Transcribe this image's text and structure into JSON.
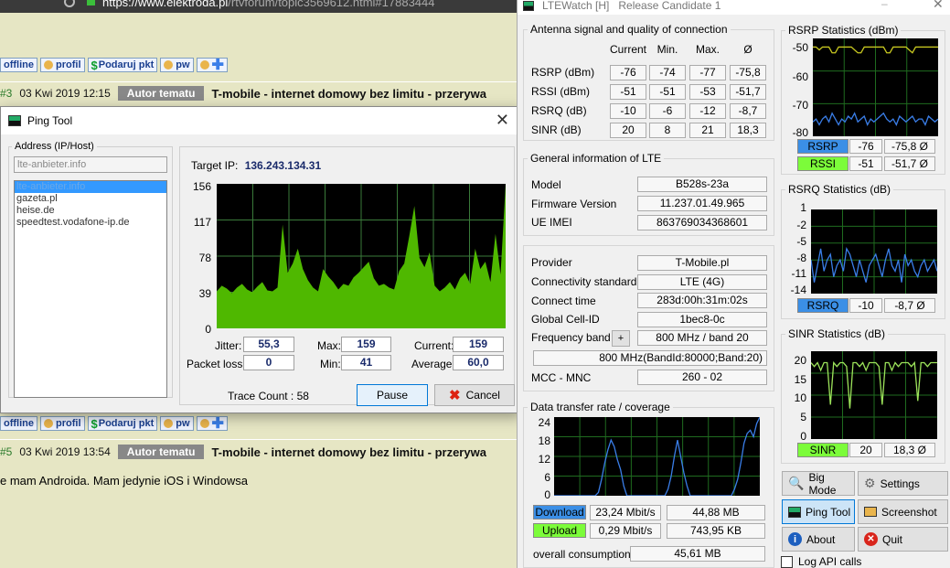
{
  "browser": {
    "url_host": "https://www.elektroda.pl",
    "url_path": "/rtvforum/topic3569612.html#17883444"
  },
  "forum": {
    "btn_offline": "offline",
    "btn_profil": "profil",
    "btn_podaruj": "Podaruj pkt",
    "btn_pw": "pw",
    "post1": {
      "num": "#3",
      "date": "03 Kwi 2019 12:15",
      "badge": "Autor tematu",
      "title": "T-mobile - internet domowy bez limitu - przerywa"
    },
    "post2": {
      "num": "#5",
      "date": "03 Kwi 2019 13:54",
      "badge": "Autor tematu",
      "title": "T-mobile - internet domowy bez limitu - przerywa"
    },
    "post2_text": "e mam Androida. Mam jedynie iOS i Windowsa"
  },
  "ping": {
    "title": "Ping Tool",
    "address_label": "Address (IP/Host)",
    "address_input": "lte-anbieter.info",
    "hosts": [
      "lte-anbieter.info",
      "gazeta.pl",
      "heise.de",
      "speedtest.vodafone-ip.de"
    ],
    "target_label": "Target IP:",
    "target_ip": "136.243.134.31",
    "y_ticks": [
      "156",
      "117",
      "78",
      "39",
      "0"
    ],
    "jitter_label": "Jitter:",
    "jitter": "55,3",
    "max_label": "Max:",
    "max": "159",
    "current_label": "Current:",
    "current": "159",
    "loss_label": "Packet loss:",
    "loss": "0",
    "min_label": "Min:",
    "min": "41",
    "avg_label": "Average:",
    "avg": "60,0",
    "trace_count": "Trace Count : 58",
    "pause": "Pause",
    "cancel": "Cancel",
    "colors": {
      "fill": "#4fb800",
      "grid": "#3a7a3a"
    },
    "samples": [
      40,
      46,
      43,
      38,
      44,
      48,
      42,
      39,
      45,
      50,
      41,
      40,
      44,
      112,
      60,
      70,
      86,
      64,
      52,
      44,
      40,
      64,
      56,
      50,
      42,
      48,
      46,
      55,
      60,
      66,
      72,
      54,
      46,
      48,
      44,
      42,
      62,
      70,
      100,
      132,
      76,
      66,
      82,
      46,
      40,
      44,
      50,
      42,
      54,
      60,
      48,
      86,
      64,
      72,
      50,
      102,
      58,
      159
    ]
  },
  "lte": {
    "title": "LTEWatch [H]   Release Candidate 1",
    "antenna": {
      "title": "Antenna signal and quality of connection",
      "cols": [
        "Current",
        "Min.",
        "Max.",
        "Ø"
      ],
      "rows": [
        {
          "label": "RSRP (dBm)",
          "v": [
            "-76",
            "-74",
            "-77",
            "-75,8"
          ]
        },
        {
          "label": "RSSI (dBm)",
          "v": [
            "-51",
            "-51",
            "-53",
            "-51,7"
          ]
        },
        {
          "label": "RSRQ (dB)",
          "v": [
            "-10",
            "-6",
            "-12",
            "-8,7"
          ]
        },
        {
          "label": "SINR (dB)",
          "v": [
            "20",
            "8",
            "21",
            "18,3"
          ]
        }
      ]
    },
    "general": {
      "title": "General information of LTE",
      "rows": [
        {
          "label": "Model",
          "value": "B528s-23a"
        },
        {
          "label": "Firmware Version",
          "value": "11.237.01.49.965"
        },
        {
          "label": "UE IMEI",
          "value": "863769034368601"
        }
      ]
    },
    "provider": {
      "rows": [
        {
          "label": "Provider",
          "value": "T-Mobile.pl"
        },
        {
          "label": "Connectivity standard",
          "value": "LTE (4G)"
        },
        {
          "label": "Connect time",
          "value": "283d:00h:31m:02s"
        },
        {
          "label": "Global Cell-ID",
          "value": "1bec8-0c"
        },
        {
          "label": "Frequency band",
          "value": "800 MHz / band 20"
        }
      ],
      "plus": "+",
      "band_detail": "800 MHz(BandId:80000;Band:20)",
      "mcc_label": "MCC - MNC",
      "mcc_value": "260 - 02"
    },
    "transfer": {
      "title": "Data transfer rate / coverage",
      "y_ticks": [
        "24",
        "18",
        "12",
        "6",
        "0"
      ],
      "download_label": "Download",
      "download_rate": "23,24 Mbit/s",
      "download_total": "44,88 MB",
      "upload_label": "Upload",
      "upload_rate": "0,29 Mbit/s",
      "upload_total": "743,95 KB",
      "overall_label": "overall consumption",
      "overall_value": "45,61 MB",
      "series": [
        0,
        0,
        0,
        0,
        0,
        0,
        0,
        0,
        0,
        0,
        0,
        0,
        0,
        0,
        1,
        5,
        10,
        14,
        17,
        15,
        11,
        8,
        3,
        0,
        0,
        0,
        0,
        0,
        0,
        0,
        0,
        0,
        0,
        0,
        0,
        0,
        2,
        6,
        12,
        17,
        12,
        7,
        3,
        0,
        0,
        0,
        0,
        0,
        0,
        0,
        0,
        0,
        0,
        0,
        0,
        0,
        0,
        2,
        5,
        10,
        16,
        19,
        20,
        18,
        22,
        24
      ]
    },
    "rsrp_stats": {
      "title": "RSRP Statistics (dBm)",
      "y_ticks": [
        "-50",
        "-60",
        "-70",
        "-80"
      ],
      "rsrp_label": "RSRP",
      "rsrp_cur": "-76",
      "rsrp_avg": "-75,8 Ø",
      "rssi_label": "RSSI",
      "rssi_cur": "-51",
      "rssi_avg": "-51,7 Ø",
      "rsrp_series": [
        -77,
        -76,
        -78,
        -76,
        -75,
        -77,
        -74,
        -76,
        -78,
        -76,
        -77,
        -75,
        -76,
        -74,
        -77,
        -76,
        -75,
        -78,
        -76,
        -77,
        -76,
        -75,
        -74,
        -76,
        -77,
        -76,
        -78,
        -75,
        -76,
        -77,
        -76,
        -75,
        -77,
        -76,
        -76,
        -78,
        -75,
        -76,
        -77,
        -76
      ],
      "rssi_series": [
        -51,
        -51,
        -52,
        -51,
        -51,
        -51,
        -53,
        -53,
        -51,
        -51,
        -51,
        -51,
        -51,
        -52,
        -53,
        -53,
        -51,
        -51,
        -51,
        -51,
        -51,
        -51,
        -51,
        -53,
        -53,
        -51,
        -51,
        -51,
        -51,
        -51,
        -52,
        -53,
        -51,
        -51,
        -51,
        -51,
        -51,
        -51,
        -51,
        -51
      ]
    },
    "rsrq_stats": {
      "title": "RSRQ Statistics (dB)",
      "y_ticks": [
        "1",
        "-2",
        "-5",
        "-8",
        "-11",
        "-14"
      ],
      "label": "RSRQ",
      "cur": "-10",
      "avg": "-8,7 Ø",
      "series": [
        -8,
        -12,
        -9,
        -6,
        -10,
        -8,
        -7,
        -11,
        -9,
        -8,
        -10,
        -6,
        -7,
        -9,
        -11,
        -8,
        -10,
        -12,
        -9,
        -8,
        -7,
        -9,
        -11,
        -8,
        -6,
        -9,
        -10,
        -8,
        -12,
        -7,
        -9,
        -8,
        -10,
        -11,
        -9,
        -8,
        -10,
        -9,
        -8,
        -10
      ]
    },
    "sinr_stats": {
      "title": "SINR Statistics (dB)",
      "y_ticks": [
        "20",
        "15",
        "10",
        "5",
        "0"
      ],
      "label": "SINR",
      "cur": "20",
      "avg": "18,3 Ø",
      "series": [
        20,
        19,
        20,
        18,
        20,
        20,
        9,
        20,
        19,
        20,
        20,
        19,
        8,
        20,
        20,
        19,
        20,
        18,
        20,
        20,
        20,
        19,
        9,
        20,
        20,
        18,
        20,
        19,
        20,
        20,
        20,
        19,
        20,
        10,
        20,
        20,
        19,
        20,
        20,
        20
      ]
    },
    "buttons": {
      "big_mode": "Big Mode",
      "settings": "Settings",
      "ping_tool": "Ping Tool",
      "screenshot": "Screenshot",
      "about": "About",
      "quit": "Quit",
      "log_api": "Log API calls"
    },
    "colors": {
      "rsrp_tag": "#3b8fe6",
      "rssi_tag": "#7cfc3a",
      "grid": "#1f6b1f",
      "sinr_line": "#9ce35a",
      "blue_line": "#3a7ee8"
    }
  }
}
